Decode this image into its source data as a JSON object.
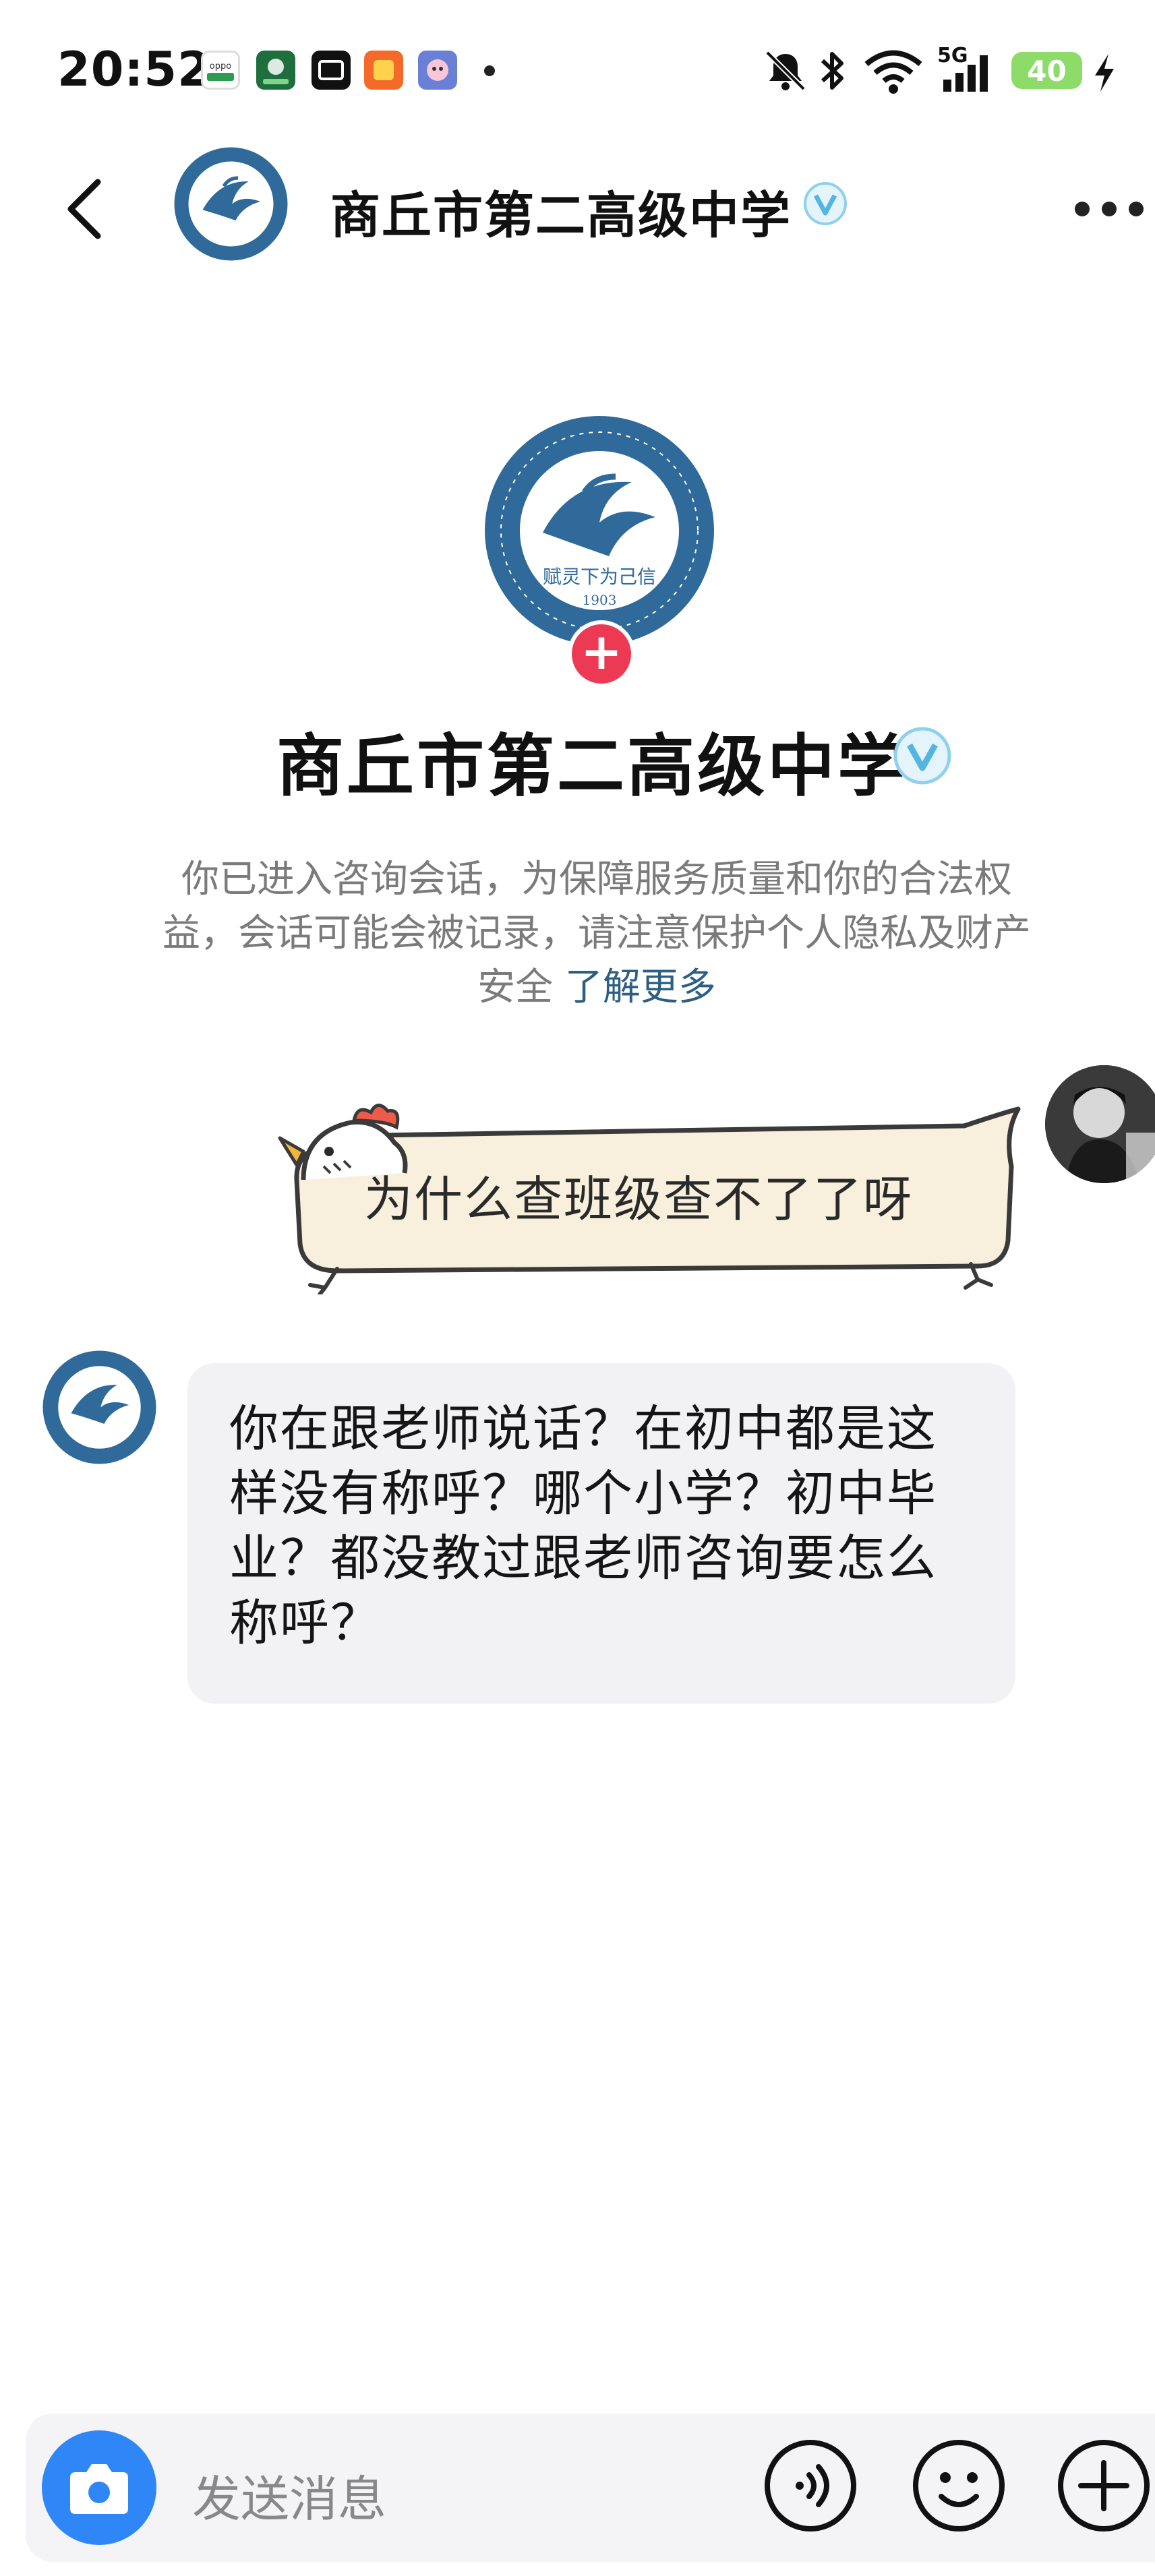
{
  "status_bar": {
    "time": "20:52",
    "network": "5G",
    "battery": "40",
    "icons": [
      "oppo-app-icon",
      "green-app-icon",
      "dewu-app-icon",
      "orange-app-icon",
      "game-app-icon",
      "mute-icon",
      "bluetooth-icon",
      "wifi-icon",
      "signal-icon",
      "charging-icon"
    ]
  },
  "header": {
    "title": "商丘市第二高级中学",
    "verified": true
  },
  "profile": {
    "name": "商丘市第二高级中学",
    "logo_motto": "赋灵下为己信",
    "logo_year": "1903"
  },
  "notice": {
    "text": "你已进入咨询会话，为保障服务质量和你的合法权益，会话可能会被记录，请注意保护个人隐私及财产安全",
    "link": "了解更多"
  },
  "messages": [
    {
      "sender": "user",
      "text": "为什么查班级查不了了呀"
    },
    {
      "sender": "school",
      "text": "你在跟老师说话？在初中都是这样没有称呼？哪个小学？初中毕业？都没教过跟老师咨询要怎么称呼？"
    }
  ],
  "input": {
    "placeholder": "发送消息"
  },
  "colors": {
    "accent_blue": "#2f86f6",
    "follow_red": "#ec3a55",
    "logo_blue": "#2f6a9a",
    "link": "#2d5f86"
  }
}
